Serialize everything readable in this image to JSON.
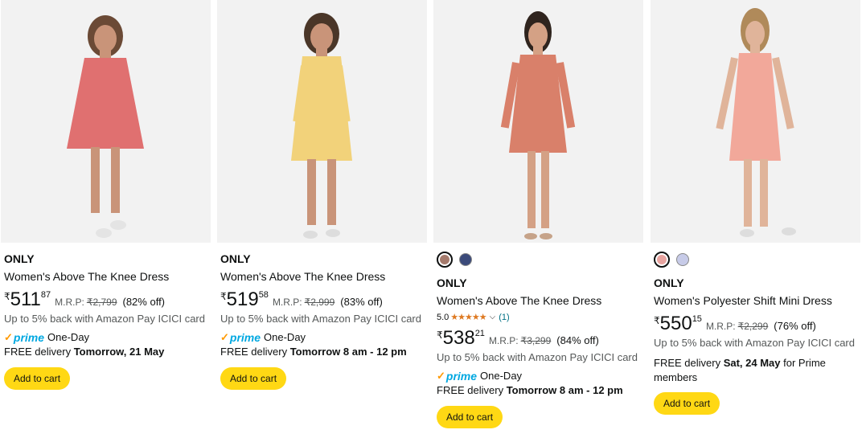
{
  "colors": {
    "button": "#ffd814",
    "link": "#007185",
    "prime": "#00a8e1",
    "star": "#de7921"
  },
  "products": [
    {
      "swatches": [],
      "brand": "ONLY",
      "title": "Women's Above The Knee Dress",
      "currency": "₹",
      "price_whole": "511",
      "price_fraction": "87",
      "mrp_label": "M.R.P:",
      "mrp": "₹2,799",
      "discount": "(82% off)",
      "cashback": "Up to 5% back with Amazon Pay ICICI card",
      "prime_badge": "prime",
      "prime_text": "One-Day",
      "delivery_prefix": "FREE delivery ",
      "delivery_date": "Tomorrow, 21 May",
      "delivery_suffix": "",
      "button": "Add to cart",
      "dress_color": "#e07070"
    },
    {
      "swatches": [],
      "brand": "ONLY",
      "title": "Women's Above The Knee Dress",
      "currency": "₹",
      "price_whole": "519",
      "price_fraction": "58",
      "mrp_label": "M.R.P:",
      "mrp": "₹2,999",
      "discount": "(83% off)",
      "cashback": "Up to 5% back with Amazon Pay ICICI card",
      "prime_badge": "prime",
      "prime_text": "One-Day",
      "delivery_prefix": "FREE delivery ",
      "delivery_date": "Tomorrow 8 am - 12 pm",
      "delivery_suffix": "",
      "button": "Add to cart",
      "dress_color": "#f2d27a"
    },
    {
      "swatches": [
        "#a57a6c",
        "#3b4a7a"
      ],
      "brand": "ONLY",
      "title": "Women's Above The Knee Dress",
      "rating": "5.0",
      "stars": "★★★★★",
      "rating_count": "(1)",
      "currency": "₹",
      "price_whole": "538",
      "price_fraction": "21",
      "mrp_label": "M.R.P:",
      "mrp": "₹3,299",
      "discount": "(84% off)",
      "cashback": "Up to 5% back with Amazon Pay ICICI card",
      "prime_badge": "prime",
      "prime_text": "One-Day",
      "delivery_prefix": "FREE delivery ",
      "delivery_date": "Tomorrow 8 am - 12 pm",
      "delivery_suffix": "",
      "button": "Add to cart",
      "dress_color": "#d9806a"
    },
    {
      "swatches": [
        "#e8a4a0",
        "#c7cbe8"
      ],
      "brand": "ONLY",
      "title": "Women's Polyester Shift Mini Dress",
      "currency": "₹",
      "price_whole": "550",
      "price_fraction": "15",
      "mrp_label": "M.R.P:",
      "mrp": "₹2,299",
      "discount": "(76% off)",
      "cashback": "Up to 5% back with Amazon Pay ICICI card",
      "prime_badge": "",
      "prime_text": "",
      "delivery_prefix": "FREE delivery ",
      "delivery_date": "Sat, 24 May",
      "delivery_suffix": " for Prime members",
      "button": "Add to cart",
      "dress_color": "#f2a89a"
    }
  ]
}
